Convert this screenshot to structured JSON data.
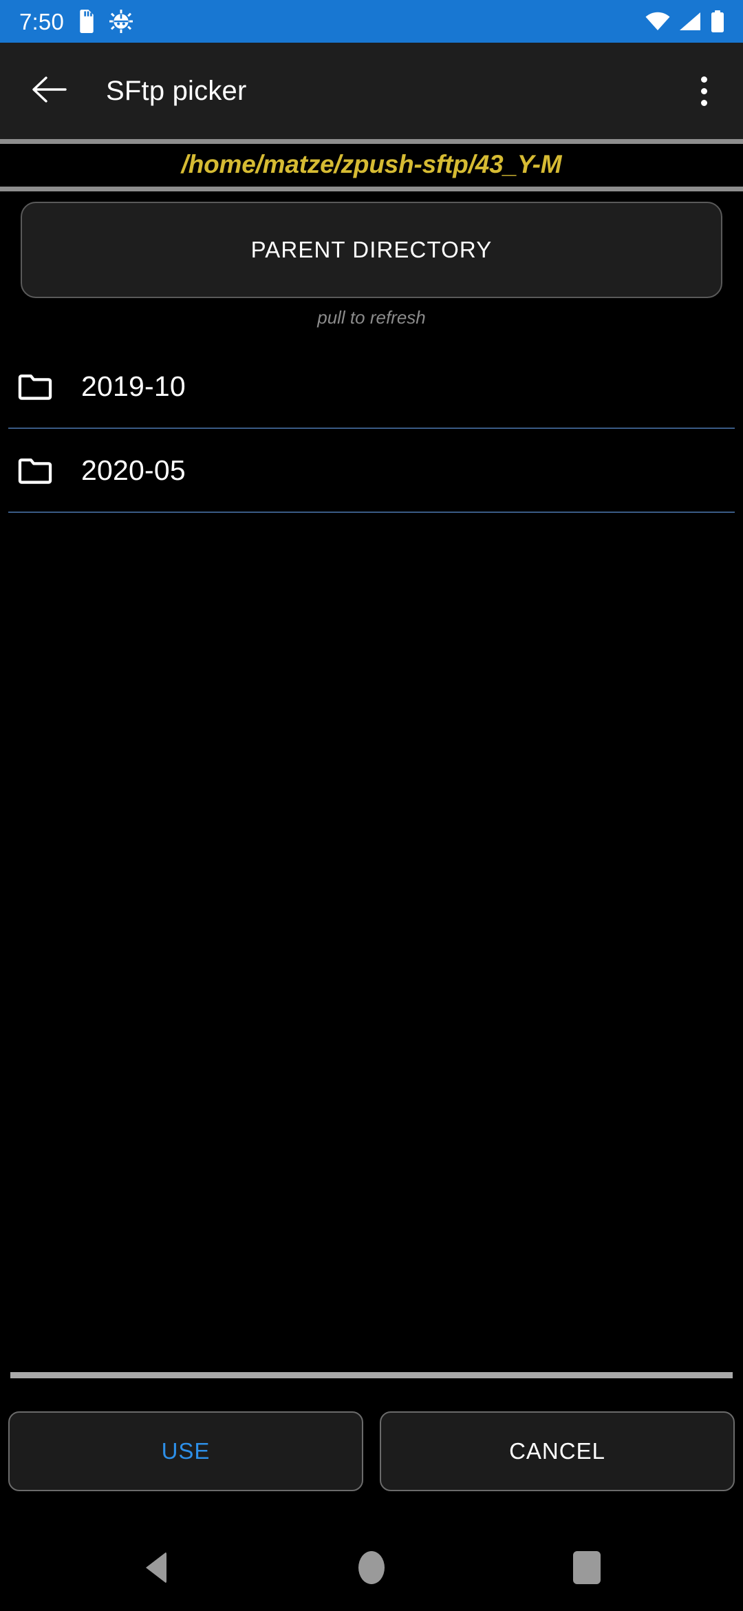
{
  "status_bar": {
    "time": "7:50",
    "background_color": "#1877D2",
    "left_icons": [
      "sd-card-icon",
      "android-debug-icon"
    ],
    "right_icons": [
      "wifi-icon",
      "cellular-signal-icon",
      "battery-full-icon"
    ]
  },
  "app_bar": {
    "back_icon": "back-arrow-icon",
    "title": "SFtp picker",
    "overflow_icon": "overflow-menu-icon",
    "background_color": "#1E1E1E"
  },
  "path_bar": {
    "path": "/home/matze/zpush-sftp/43_Y-M",
    "text_color": "#D6BB33"
  },
  "parent_directory": {
    "label": "PARENT DIRECTORY",
    "hint": "pull to refresh"
  },
  "file_list": {
    "items": [
      {
        "icon": "folder-icon",
        "name": "2019-10"
      },
      {
        "icon": "folder-icon",
        "name": "2020-05"
      }
    ],
    "divider_color": "#3A5B86"
  },
  "actions": {
    "use_label": "USE",
    "cancel_label": "CANCEL",
    "use_color": "#2D8FE8",
    "cancel_color": "#FFFFFF"
  },
  "nav_bar": {
    "back_icon": "nav-back-icon",
    "home_icon": "nav-home-icon",
    "recents_icon": "nav-recents-icon",
    "icon_color": "#9A9A9A"
  }
}
